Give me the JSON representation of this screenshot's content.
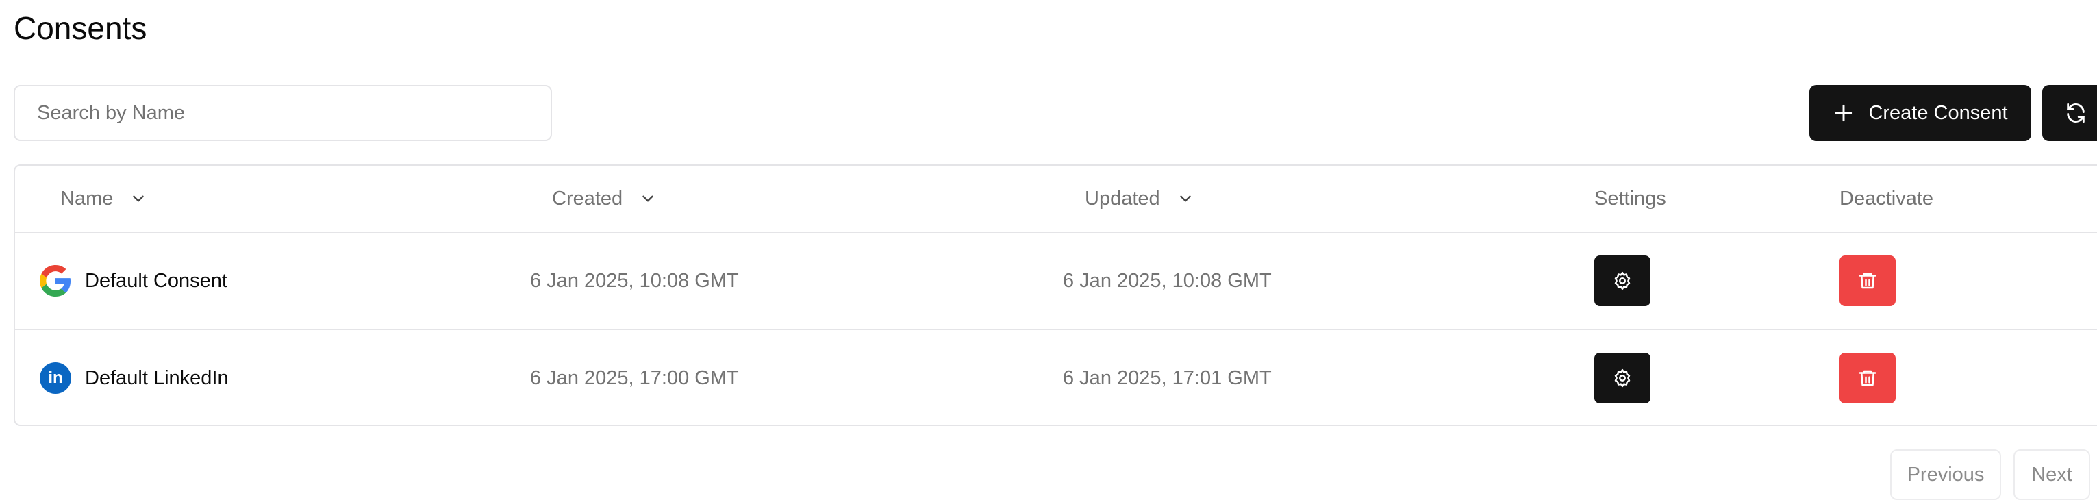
{
  "page": {
    "title": "Consents"
  },
  "search": {
    "placeholder": "Search by Name"
  },
  "toolbar": {
    "create_label": "Create Consent"
  },
  "table": {
    "columns": {
      "name": "Name",
      "created": "Created",
      "updated": "Updated",
      "settings": "Settings",
      "deactivate": "Deactivate"
    },
    "rows": [
      {
        "provider": "google",
        "name": "Default Consent",
        "created": "6 Jan 2025, 10:08 GMT",
        "updated": "6 Jan 2025, 10:08 GMT"
      },
      {
        "provider": "linkedin",
        "name": "Default LinkedIn",
        "created": "6 Jan 2025, 17:00 GMT",
        "updated": "6 Jan 2025, 17:01 GMT"
      }
    ]
  },
  "pagination": {
    "previous": "Previous",
    "next": "Next"
  },
  "colors": {
    "primary": "#141414",
    "danger": "#ef4444",
    "border": "#e4e4e7",
    "muted_text": "#737373",
    "linkedin": "#0a66c2"
  },
  "icons": {
    "create": "plus-icon",
    "refresh": "refresh-icon",
    "sort": "chevron-down-icon",
    "settings": "gear-icon",
    "deactivate": "trash-icon"
  }
}
